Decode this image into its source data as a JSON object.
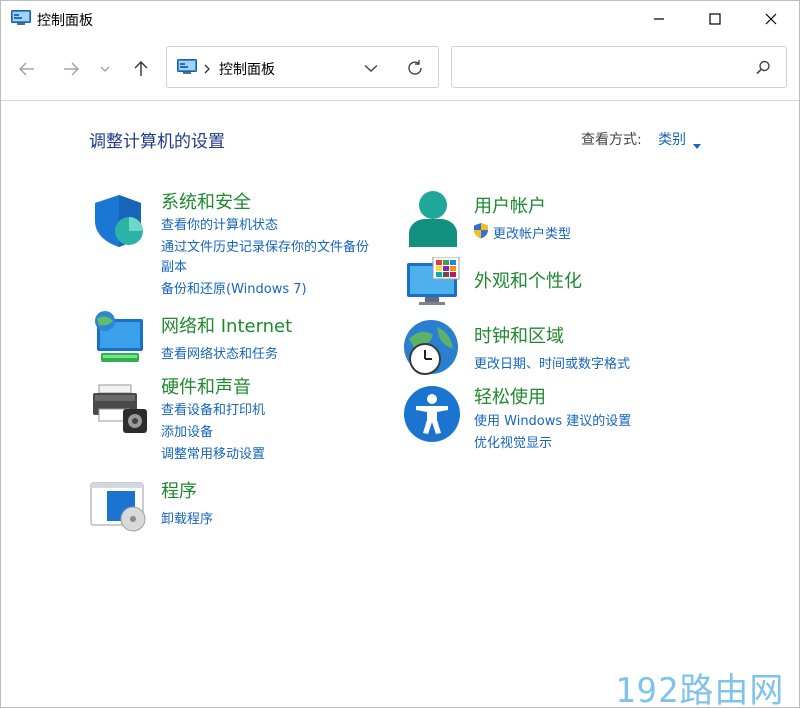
{
  "window": {
    "title": "控制面板"
  },
  "nav": {
    "address_text": "控制面板",
    "search_placeholder": ""
  },
  "content": {
    "page_title": "调整计算机的设置",
    "view_by_label": "查看方式:",
    "view_by_value": "类别"
  },
  "categories": {
    "system_security": {
      "title": "系统和安全",
      "links": [
        "查看你的计算机状态",
        "通过文件历史记录保存你的文件备份",
        "副本",
        "备份和还原(Windows 7)"
      ]
    },
    "network": {
      "title": "网络和 Internet",
      "links": [
        "查看网络状态和任务"
      ]
    },
    "hardware": {
      "title": "硬件和声音",
      "links": [
        "查看设备和打印机",
        "添加设备",
        "调整常用移动设置"
      ]
    },
    "programs": {
      "title": "程序",
      "links": [
        "卸载程序"
      ]
    },
    "user_accounts": {
      "title": "用户帐户",
      "links": [
        "更改帐户类型"
      ]
    },
    "appearance": {
      "title": "外观和个性化",
      "links": []
    },
    "clock_region": {
      "title": "时钟和区域",
      "links": [
        "更改日期、时间或数字格式"
      ]
    },
    "ease_access": {
      "title": "轻松使用",
      "links": [
        "使用 Windows 建议的设置",
        "优化视觉显示"
      ]
    }
  },
  "watermark": "192路由网",
  "colors": {
    "category_title": "#1e8a2e",
    "link": "#1565c0",
    "page_title": "#1d3a8a"
  }
}
